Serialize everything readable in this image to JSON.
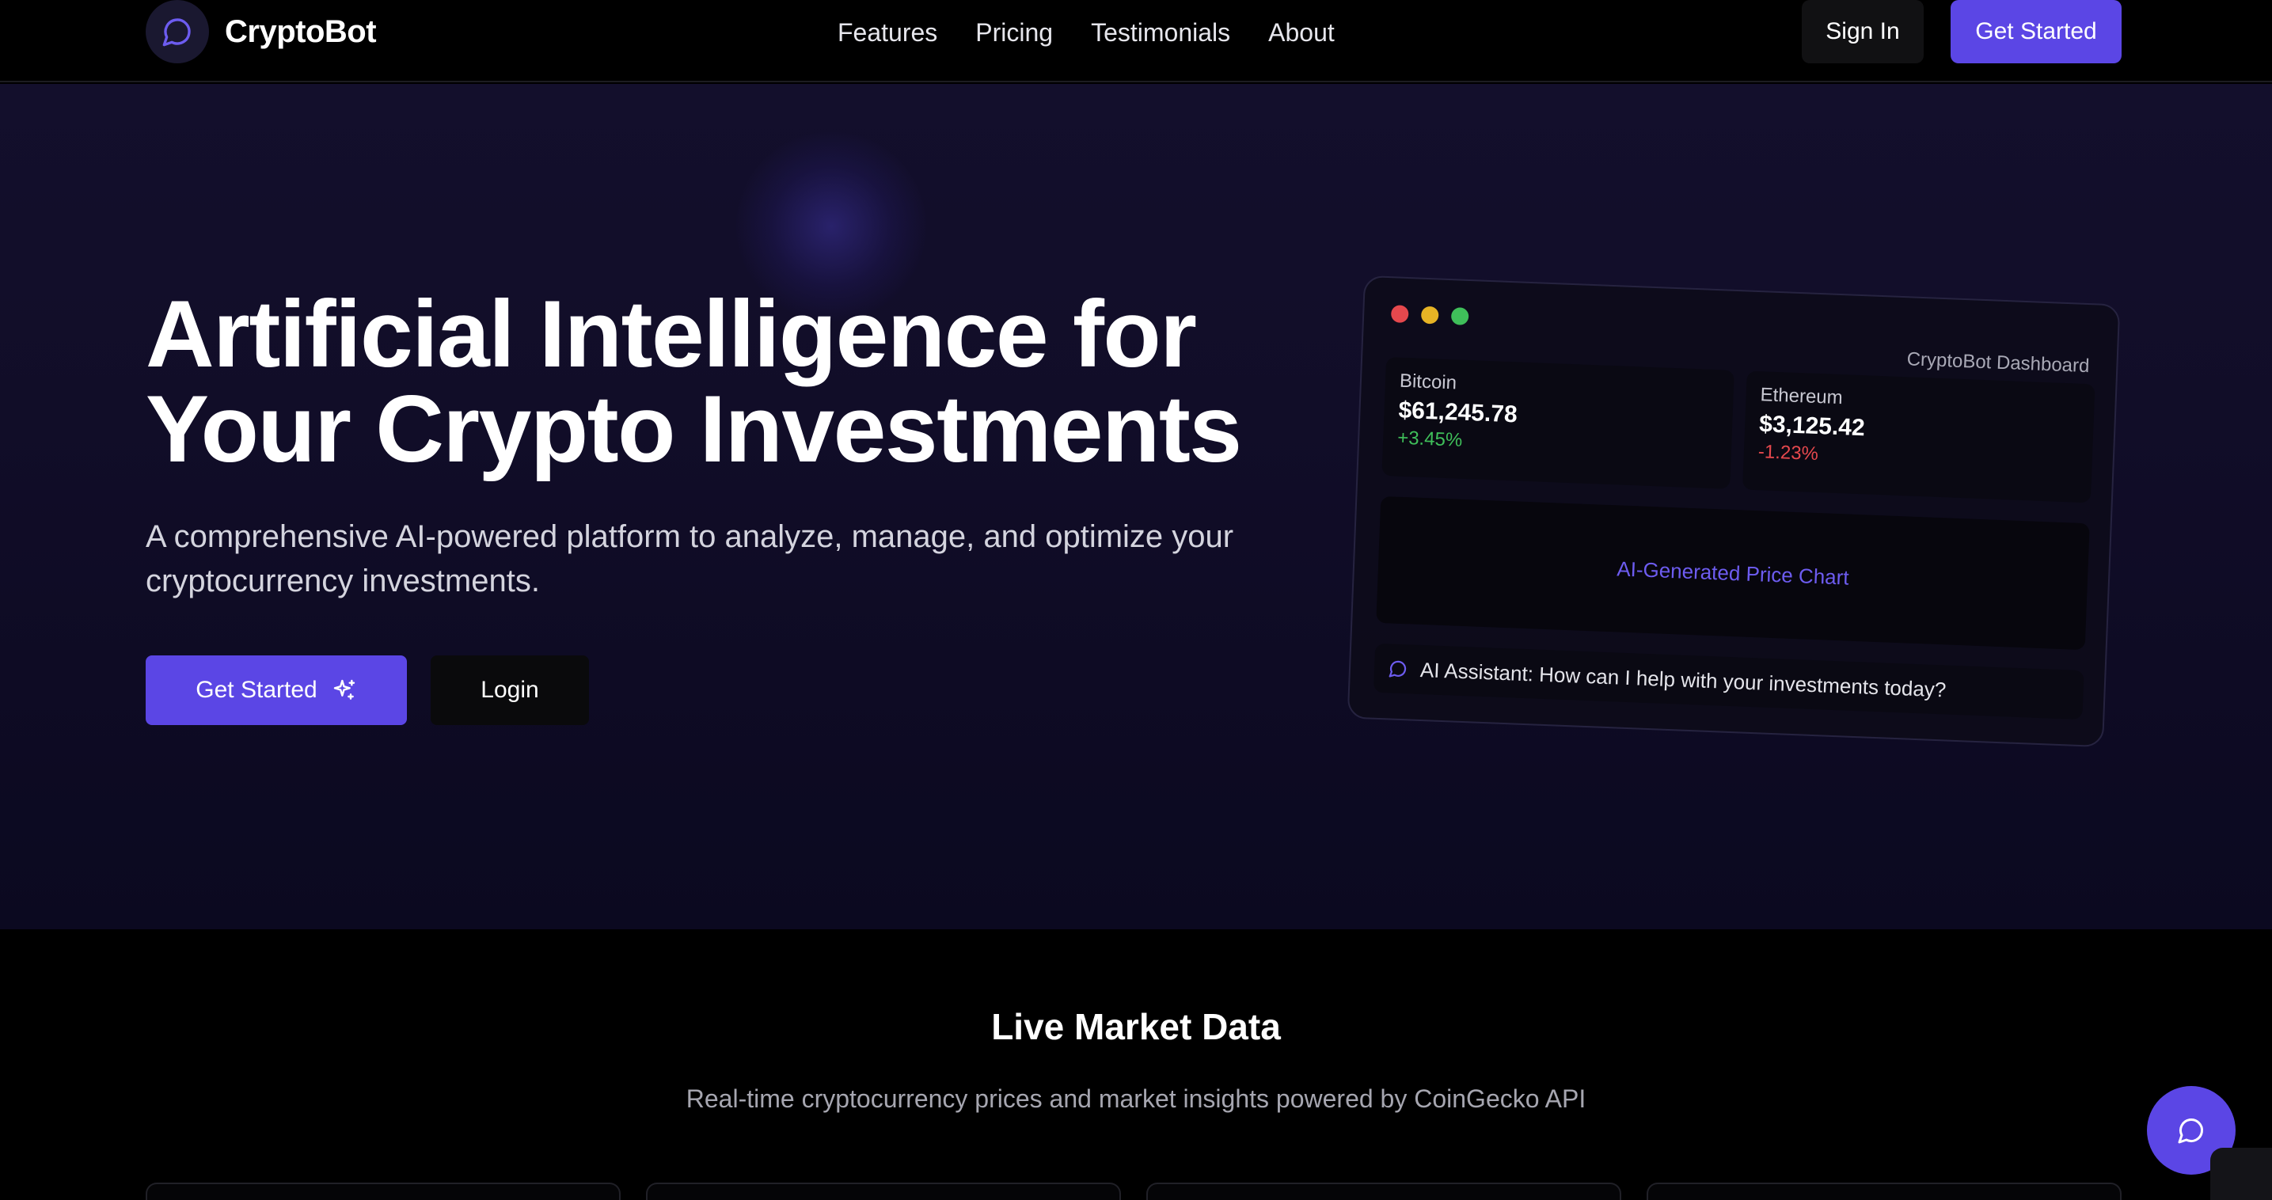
{
  "nav": {
    "brand": "CryptoBot",
    "links": [
      "Features",
      "Pricing",
      "Testimonials",
      "About"
    ],
    "sign_in": "Sign In",
    "get_started": "Get Started"
  },
  "hero": {
    "title_line1": "Artificial Intelligence for",
    "title_line2": "Your Crypto Investments",
    "subtitle": "A comprehensive AI-powered platform to analyze, manage, and optimize your cryptocurrency investments.",
    "primary_button": "Get Started",
    "secondary_button": "Login"
  },
  "dashboard": {
    "title": "CryptoBot Dashboard",
    "coins": [
      {
        "name": "Bitcoin",
        "price": "$61,245.78",
        "change": "+3.45%",
        "change_color": "#3fbf5a"
      },
      {
        "name": "Ethereum",
        "price": "$3,125.42",
        "change": "-1.23%",
        "change_color": "#e5484d"
      }
    ],
    "chart_label": "AI-Generated Price Chart",
    "assistant_text": "AI Assistant: How can I help with your investments today?",
    "window_dots": [
      "#e5484d",
      "#e6b325",
      "#3fbf5a"
    ]
  },
  "market": {
    "title": "Live Market Data",
    "subtitle": "Real-time cryptocurrency prices and market insights powered by CoinGecko API"
  },
  "colors": {
    "accent": "#5b46e5",
    "hero_bg": "#130f2c"
  },
  "icons": {
    "logo": "chat-bubble-icon",
    "primary_button": "sparkles-icon",
    "assistant": "chat-bubble-icon",
    "fab": "chat-bubble-icon"
  }
}
